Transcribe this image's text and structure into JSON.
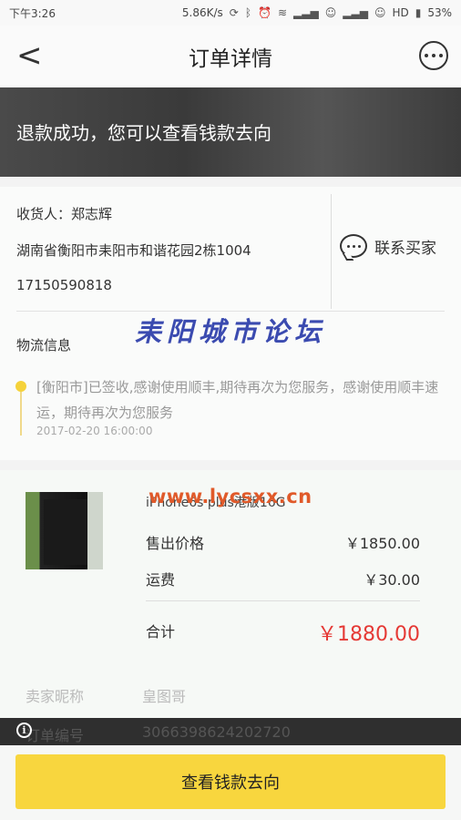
{
  "status_bar": {
    "time": "下午3:26",
    "speed": "5.86K/s",
    "hd": "HD",
    "battery": "53%"
  },
  "nav": {
    "title": "订单详情"
  },
  "banner": {
    "text": "退款成功，您可以查看钱款去向"
  },
  "address": {
    "recipient": "收货人：郑志辉",
    "street": "湖南省衡阳市耒阳市和谐花园2栋1004",
    "phone": "17150590818",
    "contact_label": "联系买家"
  },
  "logistics": {
    "title": "物流信息",
    "message": "[衡阳市]已签收,感谢使用顺丰,期待再次为您服务，感谢使用顺丰速运，期待再次为您服务",
    "time": "2017-02-20 16:00:00"
  },
  "watermarks": {
    "forum": "耒阳城市论坛",
    "url": "www.lycsxx.cn"
  },
  "goods": {
    "name": "iPhone6s plus港版16G",
    "price_label": "售出价格",
    "price_value": "￥1850.00",
    "shipping_label": "运费",
    "shipping_value": "￥30.00",
    "total_label": "合计",
    "total_value": "￥1880.00"
  },
  "seller": {
    "nickname_label": "卖家昵称",
    "nickname_value": "皇图哥",
    "order_label": "订单编号",
    "order_value": "3066398624202720"
  },
  "cta": {
    "label": "查看钱款去向"
  },
  "colors": {
    "accent": "#f8d63e",
    "price_red": "#e53935",
    "watermark_blue": "#3b4bb0",
    "watermark_orange": "#e05a2a"
  }
}
